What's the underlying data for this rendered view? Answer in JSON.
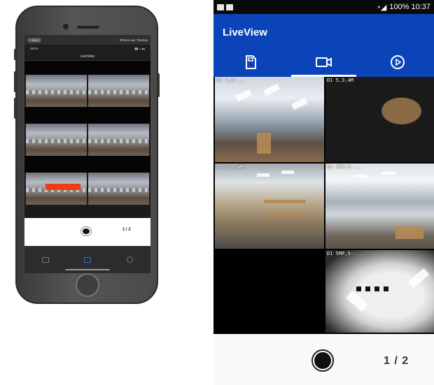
{
  "iphone": {
    "topbar_left": "< Back",
    "topbar_right": "iPhone van Thomas",
    "status_time": "09:53",
    "title": "LiveView",
    "page_indicator": "1 / 2"
  },
  "android": {
    "status_right": "100% 10:37",
    "title": "LiveView",
    "tabs": [
      {
        "icon": "sd-card-icon",
        "active": false
      },
      {
        "icon": "video-camera-icon",
        "active": true
      },
      {
        "icon": "play-circle-icon",
        "active": false
      }
    ],
    "cameras": [
      {
        "label": "D1 1,3-..."
      },
      {
        "label": "D1 5,3,4M"
      },
      {
        "label": "D1 5,3,4M"
      },
      {
        "label": "D1 5MP,5-..."
      },
      {
        "label": ""
      },
      {
        "label": "D1 5MP,5-..."
      }
    ],
    "page_indicator": "1 / 2",
    "colors": {
      "appbar": "#0a44b8",
      "statusbar": "#0a0a0a",
      "record_bar": "#ef3c14"
    }
  }
}
